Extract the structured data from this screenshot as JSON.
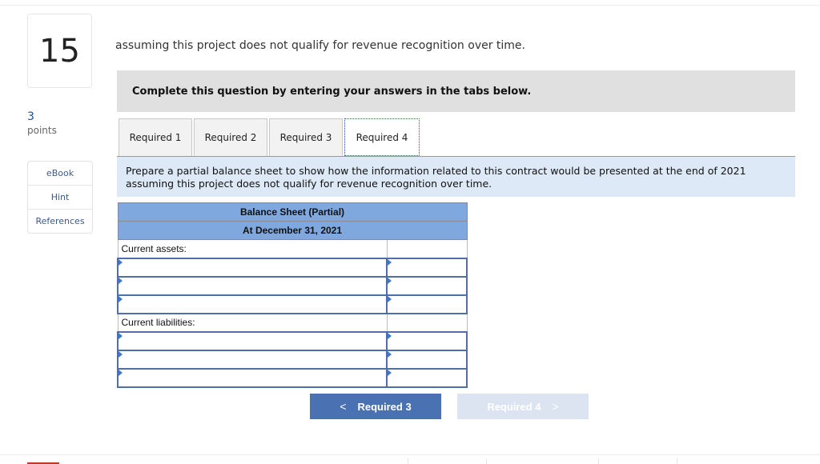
{
  "question": {
    "number": "15",
    "points_value": "3",
    "points_label": "points",
    "intro_text": "assuming this project does not qualify for revenue recognition over time."
  },
  "resources": [
    {
      "label": "eBook"
    },
    {
      "label": "Hint"
    },
    {
      "label": "References"
    }
  ],
  "instruction": "Complete this question by entering your answers in the tabs below.",
  "tabs": [
    {
      "label": "Required 1",
      "active": false
    },
    {
      "label": "Required 2",
      "active": false
    },
    {
      "label": "Required 3",
      "active": false
    },
    {
      "label": "Required 4",
      "active": true
    }
  ],
  "prompt": {
    "line1": "Prepare a partial balance sheet to show how the information related to this contract would be presented at the end of 2021",
    "line2": "assuming this project does not qualify for revenue recognition over time."
  },
  "balance_sheet": {
    "title": "Balance Sheet (Partial)",
    "date": "At December 31, 2021",
    "sections": [
      {
        "label": "Current assets:",
        "rows": [
          {
            "account": "",
            "amount": ""
          },
          {
            "account": "",
            "amount": ""
          },
          {
            "account": "",
            "amount": ""
          }
        ]
      },
      {
        "label": "Current liabilities:",
        "rows": [
          {
            "account": "",
            "amount": ""
          },
          {
            "account": "",
            "amount": ""
          },
          {
            "account": "",
            "amount": ""
          }
        ]
      }
    ]
  },
  "navigation": {
    "prev_label": "Required 3",
    "next_label": "Required 4",
    "prev_icon": "chevron-left-icon",
    "next_icon": "chevron-right-icon",
    "prev_chevron": "<",
    "next_chevron": ">",
    "next_disabled": true
  },
  "colors": {
    "header_blue": "#7fa8df",
    "prompt_bg": "#dde9f7",
    "button_primary": "#4a72b3",
    "button_disabled": "#dbe4f0"
  }
}
